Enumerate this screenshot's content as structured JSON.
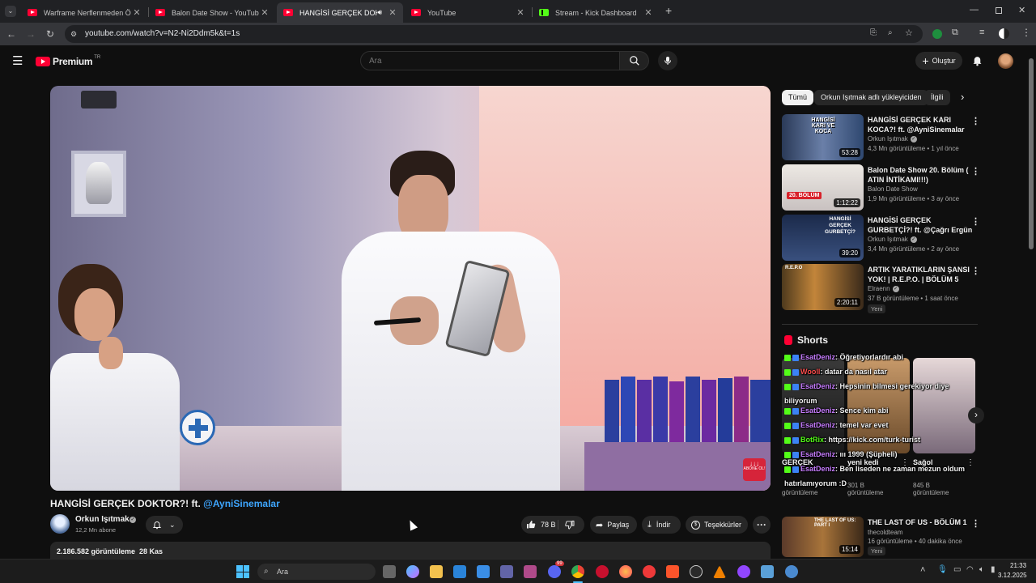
{
  "browser": {
    "tabs": [
      {
        "title": "Warframe Nerflenmeden Ö…",
        "icon": "youtube-icon"
      },
      {
        "title": "Balon Date Show - YouTube",
        "icon": "youtube-icon"
      },
      {
        "title": "HANGİSİ GERÇEK DOKTOR",
        "icon": "youtube-icon"
      },
      {
        "title": "YouTube",
        "icon": "youtube-icon"
      },
      {
        "title": "Stream - Kick Dashboard",
        "icon": "kick-icon"
      }
    ],
    "url": "youtube.com/watch?v=N2-Ni2Ddm5k&t=1s"
  },
  "header": {
    "brand": "Premium",
    "brand_sup": "TR",
    "search_placeholder": "Ara",
    "create_label": "Oluştur"
  },
  "video": {
    "title": "HANGİSİ GERÇEK DOKTOR?! ft.",
    "title_mention": "@AyniSinemalar",
    "channel": "Orkun Işıtmak",
    "subscribers": "12,2 Mn abone",
    "likes": "78 B",
    "share_label": "Paylaş",
    "download_label": "İndir",
    "thanks_label": "Teşekkürler",
    "views_date": "2.186.582 görüntüleme  28 Kas",
    "watermark": "ABONE OL!"
  },
  "chips": [
    "Tümü",
    "Orkun Işıtmak adlı yükleyiciden",
    "İlgili"
  ],
  "recommendations": [
    {
      "title": "HANGİSİ GERÇEK KARI KOCA?! ft. @AyniSinemalar",
      "channel": "Orkun Işıtmak",
      "verified": true,
      "meta": "4,3 Mn görüntüleme • 1 yıl önce",
      "duration": "53:28",
      "thumb_text": "HANGİSİ KARI VE KOCA",
      "is_new": false
    },
    {
      "title": "Balon Date Show 20. Bölüm ( ATIN İNTİKAMI!!!)",
      "channel": "Balon Date Show",
      "verified": false,
      "meta": "1,9 Mn görüntüleme • 3 ay önce",
      "duration": "1:12:22",
      "thumb_text": "20. BÖLÜM",
      "is_new": false
    },
    {
      "title": "HANGİSİ GERÇEK GURBETÇİ?! ft. @Çağrı Ergün",
      "channel": "Orkun Işıtmak",
      "verified": true,
      "meta": "3,4 Mn görüntüleme • 2 ay önce",
      "duration": "39:20",
      "thumb_text": "HANGİSİ GERÇEK GURBETÇİ?",
      "is_new": false
    },
    {
      "title": "ARTIK YARATIKLARIN ŞANSI YOK! | R.E.P.O. | BÖLÜM 5",
      "channel": "Elraenn",
      "verified": true,
      "meta": "37 B görüntüleme • 1 saat önce",
      "duration": "2:20:11",
      "thumb_text": "R.E.P.O",
      "is_new": true,
      "new_label": "Yeni"
    },
    {
      "title": "THE LAST OF US - BÖLÜM 1",
      "channel": "thecoldteam",
      "verified": false,
      "meta": "16 görüntüleme • 40 dakika önce",
      "duration": "15:14",
      "thumb_text": "THE LAST OF US: PART I",
      "is_new": true,
      "new_label": "Yeni"
    }
  ],
  "shorts": {
    "title": "Shorts",
    "items": [
      {
        "title": "GERÇEK",
        "views": "görüntüleme"
      },
      {
        "title": "yeni kedi",
        "views": "301 B görüntüleme"
      },
      {
        "title": "Sağol",
        "views": "845 B görüntüleme"
      }
    ]
  },
  "chat": [
    {
      "user": "EsatDeniz",
      "color": "#c77dff",
      "text": ": Öğretiyorlardır abi"
    },
    {
      "user": "Wooll",
      "color": "#ff4d4d",
      "text": ": datar da nasıl atar"
    },
    {
      "user": "EsatDeniz",
      "color": "#c77dff",
      "text": ": Hepsinin bilmesi gerekiyor diye"
    },
    {
      "user": "",
      "color": "#ffffff",
      "text": "biliyorum"
    },
    {
      "user": "EsatDeniz",
      "color": "#c77dff",
      "text": ": Sence kim abi"
    },
    {
      "user": "EsatDeniz",
      "color": "#c77dff",
      "text": ": temel var evet"
    },
    {
      "user": "BotRix",
      "color": "#53fc18",
      "text": ": https://kick.com/turk-turist"
    },
    {
      "user": "EsatDeniz",
      "color": "#c77dff",
      "text": ": ııı 1999 (Şüpheli)"
    },
    {
      "user": "EsatDeniz",
      "color": "#c77dff",
      "text": ": Ben liseden ne zaman mezun oldum"
    },
    {
      "user": "",
      "color": "#ffffff",
      "text": "hatırlamıyorum :D"
    }
  ],
  "taskbar": {
    "search_placeholder": "Ara",
    "time": "21:33",
    "date": "3.12.2025",
    "notification_count": "99"
  }
}
